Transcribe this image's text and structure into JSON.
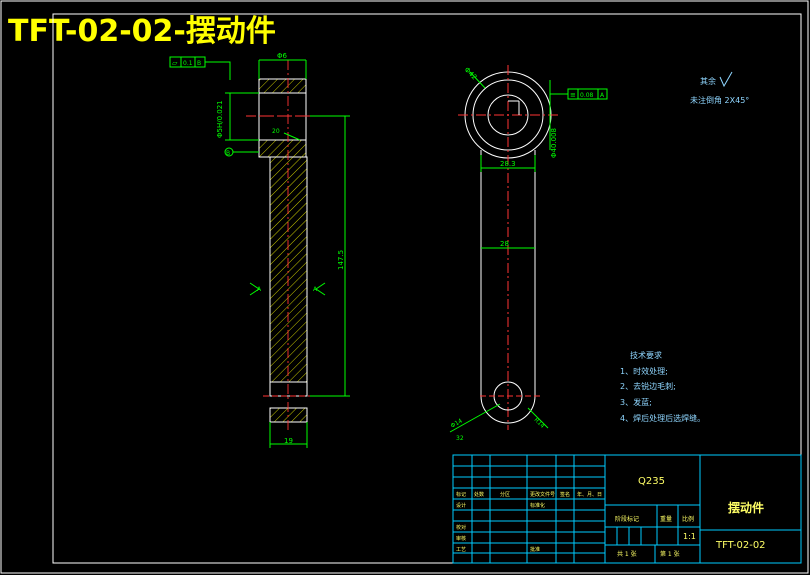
{
  "title": "TFT-02-02-摆动件",
  "side_view": {
    "flatness_box": [
      "▱",
      "0.1",
      "B"
    ],
    "dim_top": "Φ6",
    "dim_left": "Φ5H/0.021",
    "dim_length": "147.5",
    "dim_bottom": "19",
    "note_small": "20",
    "section_mark_left": "A",
    "section_mark_right": "A",
    "datum": "B"
  },
  "front_view": {
    "dim_outer": "Φ42",
    "dim_tol": "0.08",
    "dim_tol_datum": "A",
    "dim_bore": "Φ40.008",
    "dim_width_top": "28.3",
    "dim_width_mid": "28",
    "dim_small_hole": "Φ14",
    "dim_r": "R14",
    "dim_32": "32"
  },
  "surface_note": {
    "line1": "其余",
    "line2": "未注倒角 2X45°"
  },
  "tech_req": {
    "heading": "技术要求",
    "items": [
      "1、时效处理;",
      "2、去锐边毛刺;",
      "3、发蓝;",
      "4、焊后处理后选焊缝。"
    ]
  },
  "title_block": {
    "material": "Q235",
    "part_name": "摆动件",
    "drawing_no": "TFT-02-02",
    "scale_label": "比例",
    "scale": "1:1",
    "weight_label": "重量",
    "stage_label": "阶段标记",
    "sheet_total": "共 1 张",
    "sheet_no": "第 1 张",
    "row_labels": [
      "标记",
      "处数",
      "分区",
      "更改文件号",
      "签名",
      "年、月、日"
    ],
    "left_labels": [
      "设计",
      "校对",
      "审核",
      "工艺"
    ],
    "mid_labels": [
      "标准化",
      "批准"
    ]
  }
}
